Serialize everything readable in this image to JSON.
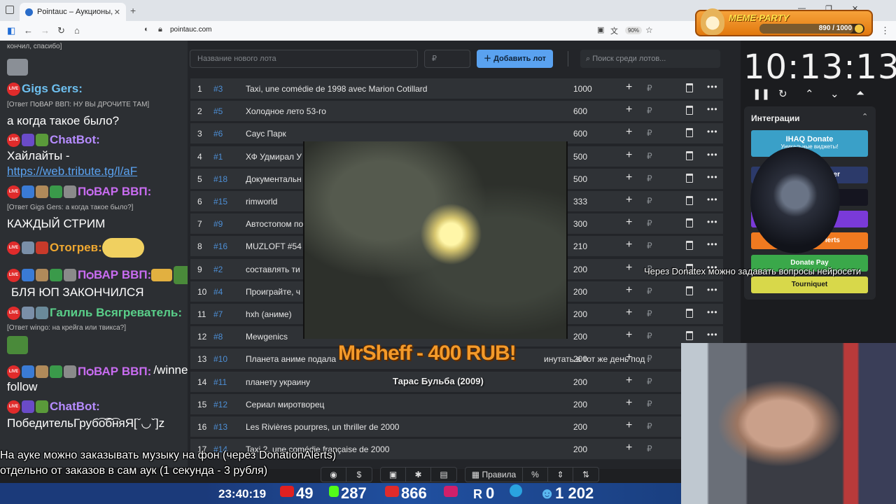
{
  "browser": {
    "tab_title": "Pointauc – Аукционы, лотереи",
    "url": "pointauc.com",
    "zoom": "90%"
  },
  "meme_party": {
    "title": "MEME·PARTY",
    "count": "890 / 1000",
    "progress": 0.89
  },
  "chat": {
    "top_fragment": "кончил, спасибо]",
    "messages": [
      {
        "user": "Gigs Gers:",
        "reply": "[Ответ ПѻВАР ВВП: НУ ВЫ ДРОЧИТЕ ТАМ]",
        "text": "а когда такое было?"
      },
      {
        "user": "ChatBot:",
        "text": "Хайлайты -",
        "link": "https://web.tribute.tg/l/aF"
      },
      {
        "user": "ПѻВАР ВВП:",
        "reply": "[Ответ Gigs Gers: а когда такое было?]",
        "text": "КАЖДЫЙ СТРИМ"
      },
      {
        "user": "Отогрев:"
      },
      {
        "user": "ПѻВАР ВВП:",
        "text": "БЛЯ ЮП ЗАКОНЧИЛСЯ"
      },
      {
        "user": "Галиль Всягреватель:",
        "reply": "[Ответ wingo: на крейга или твикса?]"
      },
      {
        "user": "ПѻВАР ВВП:",
        "text": "/winner",
        "text2": "follow"
      },
      {
        "user": "ChatBot:",
        "text": "ПобедительГруб͡о͡б͡няЯ[ˇ◡ˇ]z"
      }
    ]
  },
  "lots": {
    "new_lot_placeholder": "Название нового лота",
    "amount_placeholder": "₽",
    "add_button": "Добавить лот",
    "search_placeholder": "Поиск среди лотов...",
    "currency": "₽",
    "rows": [
      {
        "n": "1",
        "id": "#3",
        "name": "Taxi, une comédie de 1998 avec Marion Cotillard",
        "amount": "1000"
      },
      {
        "n": "2",
        "id": "#5",
        "name": "Холодное лето 53-го",
        "amount": "600"
      },
      {
        "n": "3",
        "id": "#6",
        "name": "Саус Парк",
        "amount": "600"
      },
      {
        "n": "4",
        "id": "#1",
        "name": "ХФ Удмирал У",
        "amount": "500"
      },
      {
        "n": "5",
        "id": "#18",
        "name": "Документальн",
        "amount": "500"
      },
      {
        "n": "6",
        "id": "#15",
        "name": "rimworld",
        "amount": "333"
      },
      {
        "n": "7",
        "id": "#9",
        "name": "Автостопом по",
        "amount": "300"
      },
      {
        "n": "8",
        "id": "#16",
        "name": "MUZLOFT #54",
        "amount": "210"
      },
      {
        "n": "9",
        "id": "#2",
        "name": "составлять ти",
        "amount": "200"
      },
      {
        "n": "10",
        "id": "#4",
        "name": "Проиграйте, ч",
        "amount": "200"
      },
      {
        "n": "11",
        "id": "#7",
        "name": "hxh (аниме)",
        "amount": "200"
      },
      {
        "n": "12",
        "id": "#8",
        "name": "Mewgenics",
        "amount": "200"
      },
      {
        "n": "13",
        "id": "#10",
        "name": "Планета аниме подала",
        "name_tail": "инутать в тот же день под :",
        "amount": "200"
      },
      {
        "n": "14",
        "id": "#11",
        "name": "планету украину",
        "amount": "200"
      },
      {
        "n": "15",
        "id": "#12",
        "name": "Сериал миротворец",
        "amount": "200"
      },
      {
        "n": "16",
        "id": "#13",
        "name": "Les Rivières pourpres, un thriller de 2000",
        "amount": "200"
      },
      {
        "n": "17",
        "id": "#14",
        "name": "Taxi 2, une comédie française de 2000",
        "amount": "200"
      }
    ]
  },
  "donation": {
    "title": "MrSheff - 400 RUB!",
    "message": "Тарас Бульба (2009)"
  },
  "timer": {
    "value": "10:13:13"
  },
  "integrations": {
    "title": "Интеграции",
    "buttons": [
      {
        "label": "IHAQ Donate",
        "sub": "Уникальные виджеты!"
      },
      {
        "label": "er"
      },
      {
        "label": ""
      },
      {
        "label": ""
      },
      {
        "label": "lerts"
      },
      {
        "label": "Donate Pay"
      },
      {
        "label": "Tourniquet"
      }
    ]
  },
  "ticker": "Через Donatex можно задавать вопросы нейросети",
  "bottom": {
    "line1": "На ауке можно заказывать музыку на фон (через DonationAlerts)",
    "line2": "отдельно от заказов в сам аук (1 секунда - 3 рубля)",
    "rules_label": "Правила"
  },
  "stats": {
    "clock": "23:40:19",
    "youtube": "49",
    "kick": "287",
    "live": "866",
    "r": "0",
    "viewers": "1 202"
  },
  "colors": {
    "accent": "#5aa2f0",
    "lot_id": "#4d8fd6",
    "donation": "#f39a2a",
    "meme_bar": "#f6a23a"
  }
}
